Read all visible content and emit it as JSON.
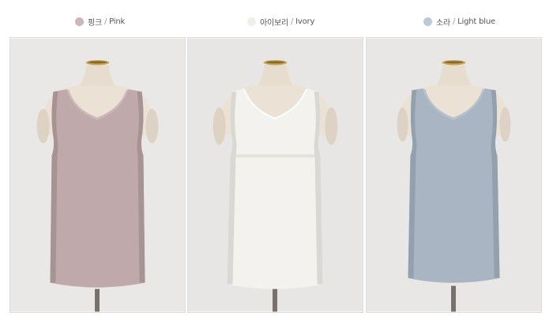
{
  "variants": [
    {
      "name_ko": "핑크",
      "separator": "/",
      "name_en": "Pink",
      "swatch_color": "#cdb6b7",
      "garment_color": "#bfa9aa",
      "shadow_color": "#a89394",
      "light_color": "#cbb8b9",
      "photo_bg": "#e9e8e6"
    },
    {
      "name_ko": "아이보리",
      "separator": "/",
      "name_en": "Ivory",
      "swatch_color": "#efefea",
      "garment_color": "#f3f2ee",
      "shadow_color": "#d9d8d2",
      "light_color": "#fbfbf9",
      "photo_bg": "#e7e6e4"
    },
    {
      "name_ko": "소라",
      "separator": "/",
      "name_en": "Light blue",
      "swatch_color": "#bcc9da",
      "garment_color": "#a9b5c2",
      "shadow_color": "#93a0ae",
      "light_color": "#b6c1cc",
      "photo_bg": "#e8e7e5"
    }
  ]
}
